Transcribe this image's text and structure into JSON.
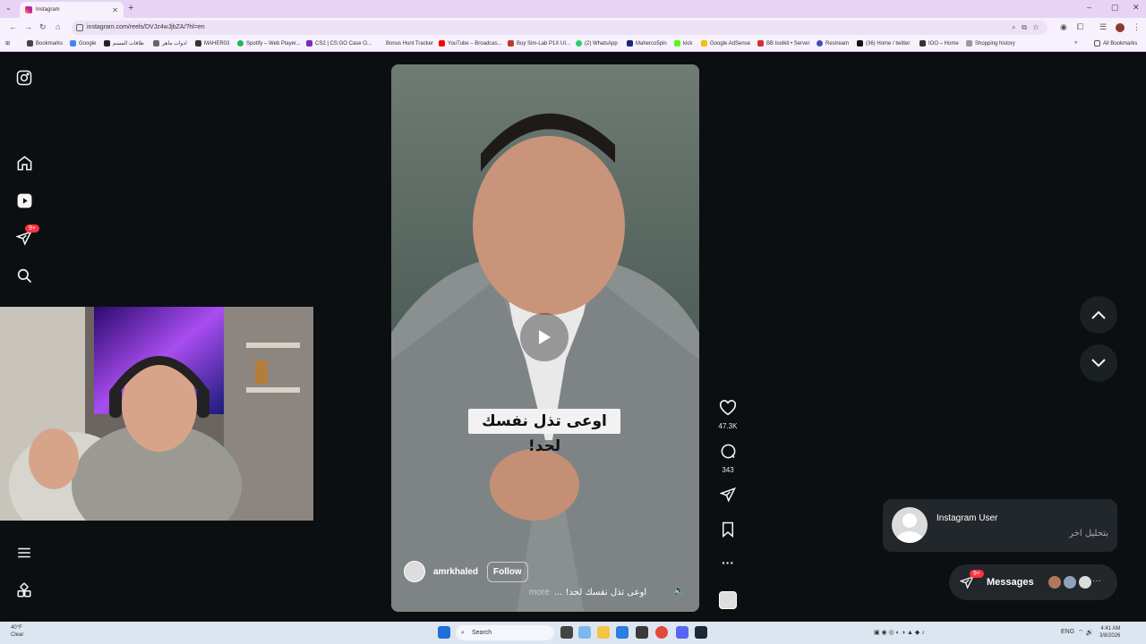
{
  "browser": {
    "tab_title": "Instagram",
    "url": "instagram.com/reels/DVJz4wJjbZA/?hl=en",
    "bookmarks": [
      "Bookmarks",
      "Google",
      "طاقات المسم",
      "ادوات ماهر",
      "MAHER03",
      "Spotify – Web Player...",
      "CS2 | CS:GO Case O...",
      "Bonus Hunt Tracker",
      "YouTube – Broadcas...",
      "Buy Sim-Lab P1X UI...",
      "(2) WhatsApp",
      "Maherco5pin",
      "kick",
      "Google AdSense",
      "BB toolkit • Server",
      "Restream",
      "(36) Home / twitter",
      "IOO – Home",
      "Shopping history"
    ],
    "all_bookmarks": "All Bookmarks"
  },
  "reel": {
    "caption_overlay": "اوعى تذل نفسك لحد!",
    "author": "amrkhaled",
    "follow_label": "Follow",
    "description": "اوعى تذل نفسك لحد! ...",
    "more": "more",
    "likes": "47.3K",
    "comments": "343"
  },
  "sidebar": {
    "notif_badge": "9+"
  },
  "notification": {
    "name": "Instagram User",
    "text": "بتحليل اخر"
  },
  "messages": {
    "label": "Messages",
    "badge": "9+"
  },
  "taskbar": {
    "temp": "40°F",
    "condition": "Clear",
    "search_placeholder": "Search",
    "lang": "ENG",
    "time": "4:41 AM",
    "date": "3/8/2026"
  },
  "colors": {
    "accent": "#ff3040",
    "background": "#0c0f12"
  }
}
